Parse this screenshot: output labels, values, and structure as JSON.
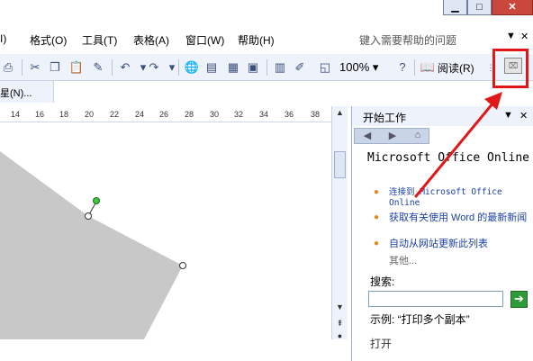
{
  "menu": {
    "items": [
      "I)",
      "格式(O)",
      "工具(T)",
      "表格(A)",
      "窗口(W)",
      "帮助(H)"
    ],
    "help_placeholder": "键入需要帮助的问题"
  },
  "toolbar": {
    "zoom": "100%",
    "read_label": "阅读(R)"
  },
  "toolbar2": {
    "label": "星(N)..."
  },
  "ruler": {
    "numbers": [
      "14",
      "16",
      "18",
      "20",
      "22",
      "24",
      "26",
      "28",
      "30",
      "32",
      "34",
      "36",
      "38"
    ]
  },
  "taskpane": {
    "title": "开始工作",
    "heading": "Microsoft Office Online",
    "links": [
      "连接到 Microsoft Office Online",
      "获取有关使用 Word 的最新新闻",
      "自动从网站更新此列表"
    ],
    "more": "其他...",
    "search_label": "搜索:",
    "example": "示例: “打印多个副本”",
    "next_section": "打开"
  },
  "colors": {
    "annotation": "#e0181a",
    "link": "#1a3fa6",
    "bullet": "#e08a1c",
    "shape_fill": "#c8c8c8"
  }
}
